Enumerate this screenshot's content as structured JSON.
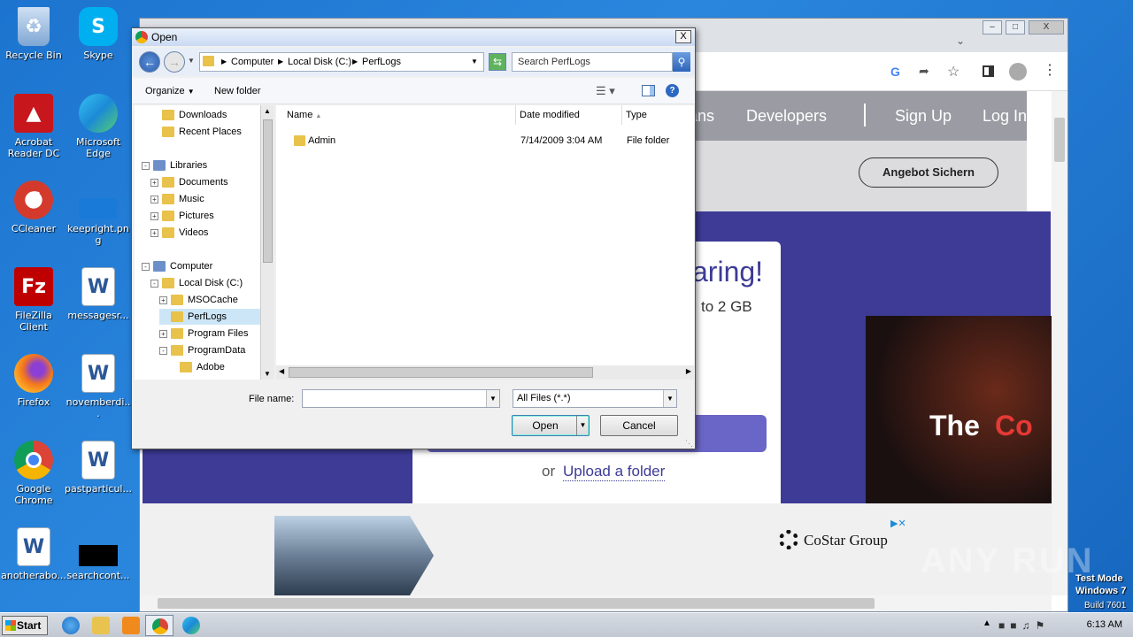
{
  "desktop": {
    "icons": [
      {
        "label": "Recycle Bin",
        "icon": "recycle-bin-icon",
        "color": "#5b8fc7"
      },
      {
        "label": "Acrobat Reader DC",
        "icon": "acrobat-icon",
        "color": "#c8161d"
      },
      {
        "label": "CCleaner",
        "icon": "ccleaner-icon",
        "color": "#d33a2c"
      },
      {
        "label": "FileZilla Client",
        "icon": "filezilla-icon",
        "color": "#bf0000"
      },
      {
        "label": "Firefox",
        "icon": "firefox-icon",
        "color": "#f4761b"
      },
      {
        "label": "Google Chrome",
        "icon": "chrome-icon",
        "color": "#2f9e44"
      },
      {
        "label": "anotherabo...",
        "icon": "word-doc-icon",
        "color": "#2b5797"
      },
      {
        "label": "Skype",
        "icon": "skype-icon",
        "color": "#00aff0"
      },
      {
        "label": "Microsoft Edge",
        "icon": "edge-icon",
        "color": "#1c8ad6"
      },
      {
        "label": "keepright.png",
        "icon": "image-file-icon",
        "color": "#1a7ad8"
      },
      {
        "label": "messagesr...",
        "icon": "word-doc-icon",
        "color": "#2b5797"
      },
      {
        "label": "novemberdi...",
        "icon": "word-doc-icon",
        "color": "#2b5797"
      },
      {
        "label": "pastparticul...",
        "icon": "word-doc-icon",
        "color": "#2b5797"
      },
      {
        "label": "searchcont...",
        "icon": "black-file-icon",
        "color": "#000000"
      }
    ],
    "watermark": {
      "brand": "ANY RUN",
      "mode": "Test Mode",
      "os": "Windows 7",
      "build": "Build 7601"
    }
  },
  "browser": {
    "nav_links": [
      "ans",
      "Developers",
      "Sign Up",
      "Log In"
    ],
    "cta_button": "Angebot Sichern",
    "hero_text": "aring!",
    "hero_sub": "to 2 GB",
    "upload_or": "or",
    "upload_folder": "Upload a folder",
    "movie_text_white": "The",
    "movie_text_red": "Co",
    "ad_brand": "CoStar Group"
  },
  "dialog": {
    "title": "Open",
    "close_label": "X",
    "breadcrumb": [
      "Computer",
      "Local Disk (C:)",
      "PerfLogs"
    ],
    "search_placeholder": "Search PerfLogs",
    "organize": "Organize",
    "new_folder": "New folder",
    "tree": [
      {
        "label": "Downloads",
        "indent": 1
      },
      {
        "label": "Recent Places",
        "indent": 1
      },
      {
        "label": "Libraries",
        "indent": 0,
        "exp": "-"
      },
      {
        "label": "Documents",
        "indent": 1,
        "exp": "+"
      },
      {
        "label": "Music",
        "indent": 1,
        "exp": "+"
      },
      {
        "label": "Pictures",
        "indent": 1,
        "exp": "+"
      },
      {
        "label": "Videos",
        "indent": 1,
        "exp": "+"
      },
      {
        "label": "Computer",
        "indent": 0,
        "exp": "-"
      },
      {
        "label": "Local Disk (C:)",
        "indent": 1,
        "exp": "-"
      },
      {
        "label": "MSOCache",
        "indent": 2,
        "exp": "+"
      },
      {
        "label": "PerfLogs",
        "indent": 2,
        "selected": true
      },
      {
        "label": "Program Files",
        "indent": 2,
        "exp": "+"
      },
      {
        "label": "ProgramData",
        "indent": 2,
        "exp": "-"
      },
      {
        "label": "Adobe",
        "indent": 3
      }
    ],
    "columns": [
      "Name",
      "Date modified",
      "Type"
    ],
    "files": [
      {
        "name": "Admin",
        "date": "7/14/2009 3:04 AM",
        "type": "File folder"
      }
    ],
    "file_name_label": "File name:",
    "file_name_value": "",
    "filter": "All Files (*.*)",
    "open_button": "Open",
    "cancel_button": "Cancel"
  },
  "taskbar": {
    "start": "Start",
    "time": "6:13 AM"
  }
}
